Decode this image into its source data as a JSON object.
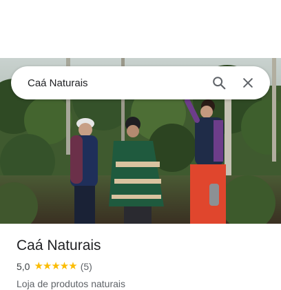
{
  "search": {
    "query": "Caá Naturais",
    "search_icon": "search-icon",
    "close_icon": "close-icon"
  },
  "photo": {
    "description_icon": "place-photo"
  },
  "place": {
    "name": "Caá Naturais",
    "rating": "5,0",
    "stars": "★★★★★",
    "review_count": "(5)",
    "category": "Loja de produtos naturais"
  },
  "colors": {
    "star": "#fbbc04",
    "text_primary": "#202124",
    "text_secondary": "#5f6368"
  }
}
